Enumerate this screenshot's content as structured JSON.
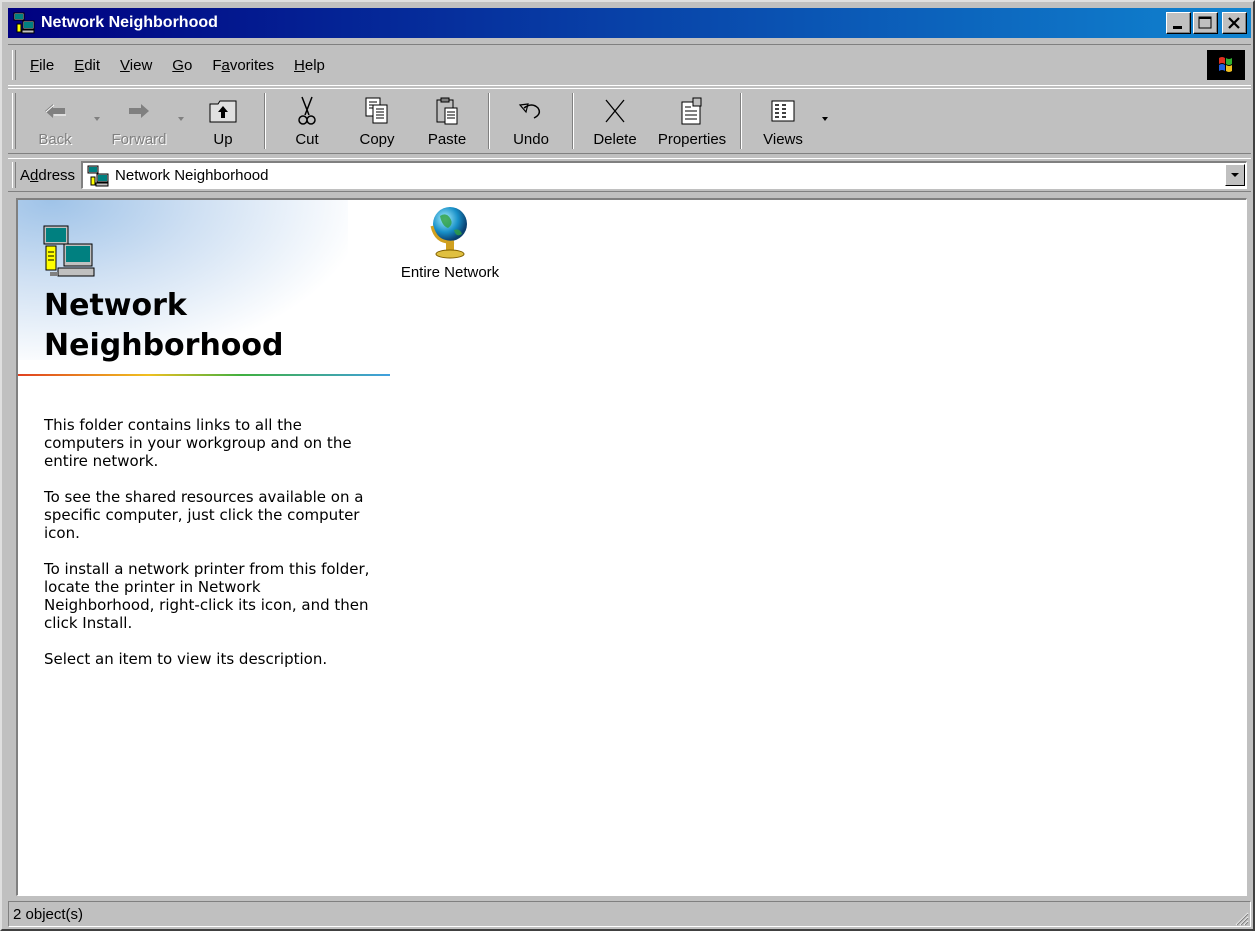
{
  "window": {
    "title": "Network Neighborhood",
    "icon": "network-neighborhood-icon",
    "controls": {
      "minimize": "minimize-icon",
      "maximize": "maximize-icon",
      "close": "close-icon"
    }
  },
  "menubar": {
    "items": [
      {
        "pre": "",
        "key": "F",
        "post": "ile"
      },
      {
        "pre": "",
        "key": "E",
        "post": "dit"
      },
      {
        "pre": "",
        "key": "V",
        "post": "iew"
      },
      {
        "pre": "",
        "key": "G",
        "post": "o"
      },
      {
        "pre": "F",
        "key": "a",
        "post": "vorites"
      },
      {
        "pre": "",
        "key": "H",
        "post": "elp"
      }
    ]
  },
  "toolbar": {
    "back": "Back",
    "forward": "Forward",
    "up": "Up",
    "cut": "Cut",
    "copy": "Copy",
    "paste": "Paste",
    "undo": "Undo",
    "delete": "Delete",
    "properties": "Properties",
    "views": "Views"
  },
  "address": {
    "label_pre": "A",
    "label_key": "d",
    "label_post": "dress",
    "value": "Network Neighborhood"
  },
  "webpane": {
    "title_line1": "Network",
    "title_line2": "Neighborhood",
    "paragraphs": [
      "This folder contains links to all the computers in your workgroup and on the entire network.",
      "To see the shared resources available on a specific computer, just click the computer icon.",
      "To install a network printer from this folder, locate the printer in Network Neighborhood, right-click its icon, and then click Install.",
      "Select an item to view its description."
    ]
  },
  "items": [
    {
      "label": "Entire Network",
      "icon": "globe-icon"
    }
  ],
  "status": {
    "text": "2 object(s)"
  },
  "colors": {
    "titlebar_start": "#000080",
    "titlebar_end": "#1084d0",
    "face": "#c0c0c0"
  }
}
